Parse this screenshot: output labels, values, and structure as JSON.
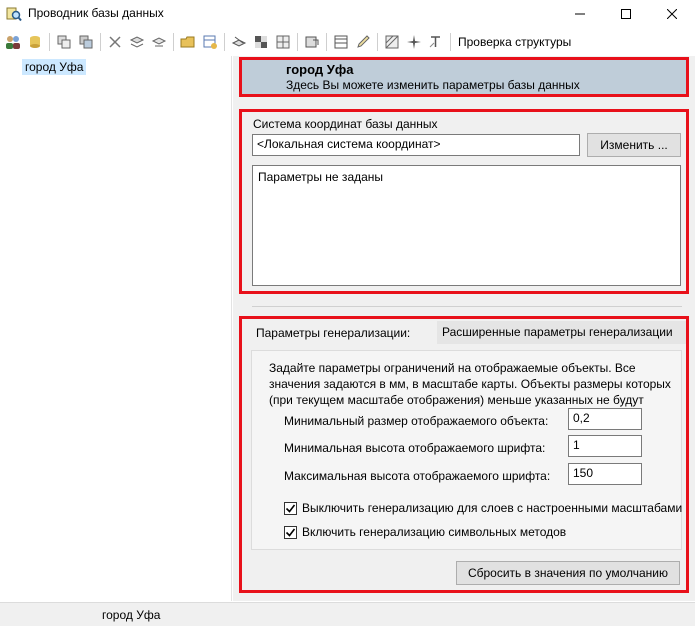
{
  "window": {
    "title": "Проводник базы данных",
    "minimize_icon": "minimize-icon",
    "maximize_icon": "maximize-icon",
    "close_icon": "close-icon"
  },
  "toolbar": {
    "check_structure_label": "Проверка структуры"
  },
  "tree": {
    "selected_item": "город Уфа"
  },
  "header": {
    "title": "город Уфа",
    "subtitle": "Здесь Вы можете изменить параметры базы данных"
  },
  "coords": {
    "label": "Система координат базы данных",
    "value": "<Локальная система координат>",
    "change_button": "Изменить ...",
    "params_text": "Параметры не заданы"
  },
  "generalization": {
    "label": "Параметры генерализации:",
    "mode_value": "Расширенные параметры генерализации",
    "description": "Задайте параметры ограничений на отображаемые объекты. Все значения задаются в мм, в масштабе карты. Объекты размеры которых (при текущем масштабе отображения) меньше указанных не будут",
    "min_object_label": "Минимальный размер отображаемого объекта:",
    "min_object_value": "0,2",
    "min_font_label": "Минимальная высота отображаемого шрифта:",
    "min_font_value": "1",
    "max_font_label": "Максимальная высота отображаемого шрифта:",
    "max_font_value": "150",
    "check1_label": "Выключить генерализацию для слоев с настроенными масштабами",
    "check1_checked": true,
    "check2_label": "Включить генерализацию символьных методов",
    "check2_checked": true,
    "reset_button": "Сбросить в значения по умолчанию"
  },
  "status": {
    "text": "город Уфа"
  },
  "colors": {
    "highlight_red": "#e8101a",
    "header_bg": "#bfcdd9",
    "tree_selection": "#cce8ff"
  }
}
